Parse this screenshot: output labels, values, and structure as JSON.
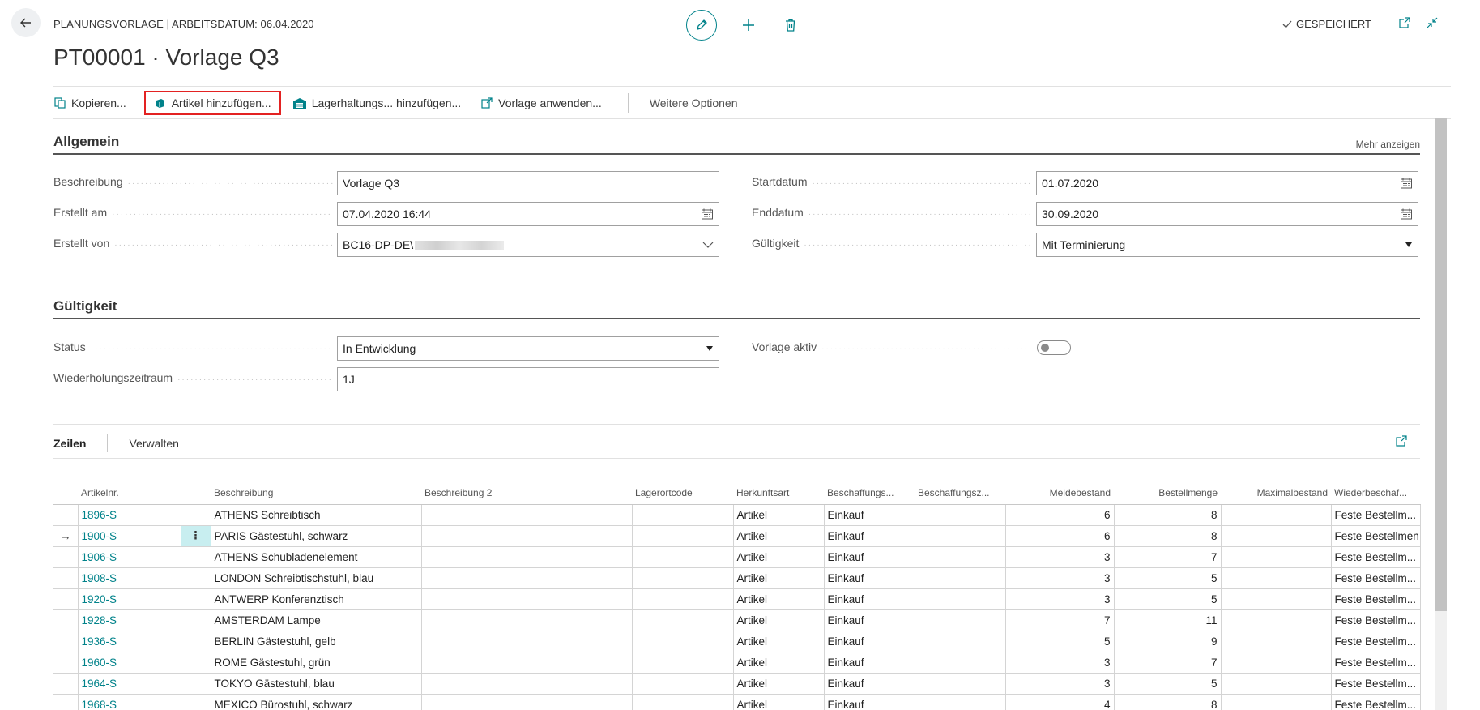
{
  "header": {
    "caption": "PLANUNGSVORLAGE | ARBEITSDATUM: 06.04.2020",
    "title": "PT00001 · Vorlage Q3",
    "saved_status": "GESPEICHERT"
  },
  "actions": {
    "copy": "Kopieren...",
    "add_items": "Artikel hinzufügen...",
    "add_sku": "Lagerhaltungs... hinzufügen...",
    "apply_template": "Vorlage anwenden...",
    "more_options": "Weitere Optionen"
  },
  "general": {
    "title": "Allgemein",
    "show_more": "Mehr anzeigen",
    "description_label": "Beschreibung",
    "description_value": "Vorlage Q3",
    "created_at_label": "Erstellt am",
    "created_at_value": "07.04.2020 16:44",
    "created_by_label": "Erstellt von",
    "created_by_value": "BC16-DP-DE\\",
    "start_date_label": "Startdatum",
    "start_date_value": "01.07.2020",
    "end_date_label": "Enddatum",
    "end_date_value": "30.09.2020",
    "validity_label": "Gültigkeit",
    "validity_value": "Mit Terminierung"
  },
  "validity": {
    "title": "Gültigkeit",
    "status_label": "Status",
    "status_value": "In Entwicklung",
    "recurrence_label": "Wiederholungszeitraum",
    "recurrence_value": "1J",
    "active_label": "Vorlage aktiv",
    "active_value": false
  },
  "lines": {
    "tab_lines": "Zeilen",
    "tab_manage": "Verwalten",
    "columns": [
      "Artikelnr.",
      "Beschreibung",
      "Beschreibung 2",
      "Lagerortcode",
      "Herkunftsart",
      "Beschaffungs...",
      "Beschaffungsz...",
      "Meldebestand",
      "Bestellmenge",
      "Maximalbestand",
      "Wiederbeschaf..."
    ],
    "rows": [
      {
        "marker": "",
        "no": "1896-S",
        "desc": "ATHENS Schreibtisch",
        "desc2": "",
        "loc": "",
        "src": "Artikel",
        "repl": "Einkauf",
        "repl_time": "",
        "reorder_point": "6",
        "order_qty": "8",
        "max_inv": "",
        "policy": "Feste Bestellm..."
      },
      {
        "marker": "→",
        "no": "1900-S",
        "desc": "PARIS Gästestuhl, schwarz",
        "desc2": "",
        "loc": "",
        "src": "Artikel",
        "repl": "Einkauf",
        "repl_time": "",
        "reorder_point": "6",
        "order_qty": "8",
        "max_inv": "",
        "policy": "Feste Bestellmen"
      },
      {
        "marker": "",
        "no": "1906-S",
        "desc": "ATHENS Schubladenelement",
        "desc2": "",
        "loc": "",
        "src": "Artikel",
        "repl": "Einkauf",
        "repl_time": "",
        "reorder_point": "3",
        "order_qty": "7",
        "max_inv": "",
        "policy": "Feste Bestellm..."
      },
      {
        "marker": "",
        "no": "1908-S",
        "desc": "LONDON Schreibtischstuhl, blau",
        "desc2": "",
        "loc": "",
        "src": "Artikel",
        "repl": "Einkauf",
        "repl_time": "",
        "reorder_point": "3",
        "order_qty": "5",
        "max_inv": "",
        "policy": "Feste Bestellm..."
      },
      {
        "marker": "",
        "no": "1920-S",
        "desc": "ANTWERP Konferenztisch",
        "desc2": "",
        "loc": "",
        "src": "Artikel",
        "repl": "Einkauf",
        "repl_time": "",
        "reorder_point": "3",
        "order_qty": "5",
        "max_inv": "",
        "policy": "Feste Bestellm..."
      },
      {
        "marker": "",
        "no": "1928-S",
        "desc": "AMSTERDAM Lampe",
        "desc2": "",
        "loc": "",
        "src": "Artikel",
        "repl": "Einkauf",
        "repl_time": "",
        "reorder_point": "7",
        "order_qty": "11",
        "max_inv": "",
        "policy": "Feste Bestellm..."
      },
      {
        "marker": "",
        "no": "1936-S",
        "desc": "BERLIN Gästestuhl, gelb",
        "desc2": "",
        "loc": "",
        "src": "Artikel",
        "repl": "Einkauf",
        "repl_time": "",
        "reorder_point": "5",
        "order_qty": "9",
        "max_inv": "",
        "policy": "Feste Bestellm..."
      },
      {
        "marker": "",
        "no": "1960-S",
        "desc": "ROME Gästestuhl, grün",
        "desc2": "",
        "loc": "",
        "src": "Artikel",
        "repl": "Einkauf",
        "repl_time": "",
        "reorder_point": "3",
        "order_qty": "7",
        "max_inv": "",
        "policy": "Feste Bestellm..."
      },
      {
        "marker": "",
        "no": "1964-S",
        "desc": "TOKYO Gästestuhl, blau",
        "desc2": "",
        "loc": "",
        "src": "Artikel",
        "repl": "Einkauf",
        "repl_time": "",
        "reorder_point": "3",
        "order_qty": "5",
        "max_inv": "",
        "policy": "Feste Bestellm..."
      },
      {
        "marker": "",
        "no": "1968-S",
        "desc": "MEXICO Bürostuhl, schwarz",
        "desc2": "",
        "loc": "",
        "src": "Artikel",
        "repl": "Einkauf",
        "repl_time": "",
        "reorder_point": "4",
        "order_qty": "8",
        "max_inv": "",
        "policy": "Feste Bestellm..."
      }
    ]
  },
  "colors": {
    "accent": "#00828a",
    "highlight_border": "#e32222",
    "active_row_cell": "#c8eef0"
  }
}
